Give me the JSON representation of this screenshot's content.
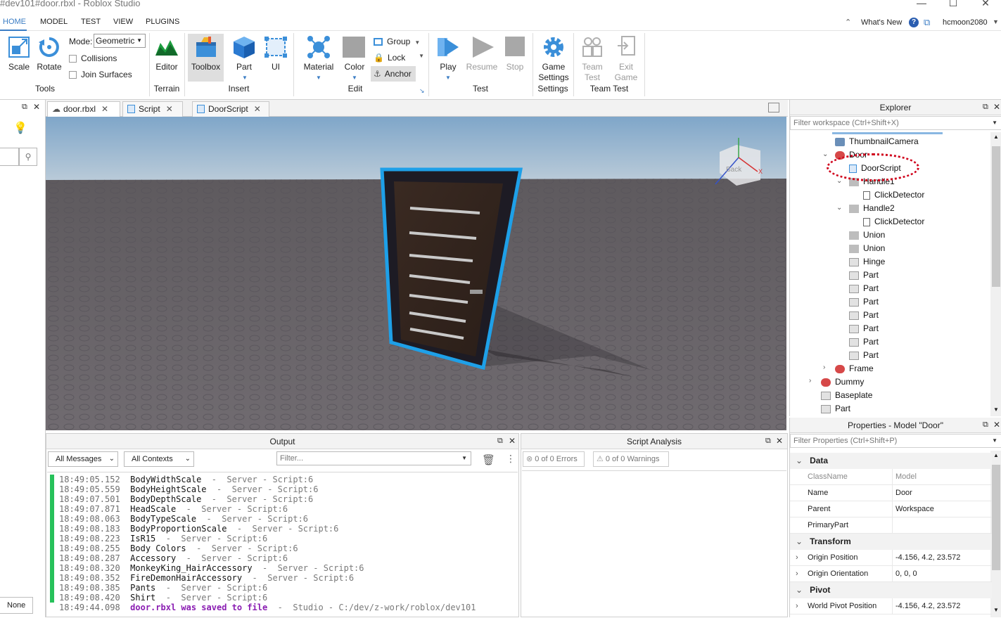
{
  "window": {
    "title": "#dev101#door.rbxl - Roblox Studio"
  },
  "menu": {
    "tabs": [
      "HOME",
      "MODEL",
      "TEST",
      "VIEW",
      "PLUGINS"
    ],
    "active": "HOME",
    "whats_new": "What's New",
    "user": "hcmoon2080"
  },
  "ribbon": {
    "tools": {
      "scale": "Scale",
      "rotate": "Rotate",
      "mode_label": "Mode:",
      "mode_value": "Geometric",
      "collisions": "Collisions",
      "join_surfaces": "Join Surfaces",
      "group": "Tools"
    },
    "terrain": {
      "editor": "Editor",
      "group": "Terrain"
    },
    "insert": {
      "toolbox": "Toolbox",
      "part": "Part",
      "ui": "UI",
      "group": "Insert"
    },
    "edit": {
      "material": "Material",
      "color": "Color",
      "group_btn": "Group",
      "lock": "Lock",
      "anchor": "Anchor",
      "group": "Edit"
    },
    "test": {
      "play": "Play",
      "resume": "Resume",
      "stop": "Stop",
      "group": "Test"
    },
    "settings": {
      "game_settings_1": "Game",
      "game_settings_2": "Settings",
      "group": "Settings"
    },
    "team_test": {
      "team_test_1": "Team",
      "team_test_2": "Test",
      "exit_game_1": "Exit",
      "exit_game_2": "Game",
      "group": "Team Test"
    }
  },
  "doc_tabs": [
    {
      "label": "door.rbxl"
    },
    {
      "label": "Script"
    },
    {
      "label": "DoorScript"
    }
  ],
  "left_panel": {
    "none_label": "None"
  },
  "output": {
    "title": "Output",
    "filter_messages": "All Messages",
    "filter_contexts": "All Contexts",
    "filter_placeholder": "Filter...",
    "logs": [
      {
        "time": "18:49:05.152",
        "msg": "BodyWidthScale",
        "src": "  -  Server - Script:6"
      },
      {
        "time": "18:49:05.559",
        "msg": "BodyHeightScale",
        "src": "  -  Server - Script:6"
      },
      {
        "time": "18:49:07.501",
        "msg": "BodyDepthScale",
        "src": "  -  Server - Script:6"
      },
      {
        "time": "18:49:07.871",
        "msg": "HeadScale",
        "src": "  -  Server - Script:6"
      },
      {
        "time": "18:49:08.063",
        "msg": "BodyTypeScale",
        "src": "  -  Server - Script:6"
      },
      {
        "time": "18:49:08.183",
        "msg": "BodyProportionScale",
        "src": "  -  Server - Script:6"
      },
      {
        "time": "18:49:08.223",
        "msg": "IsR15",
        "src": "  -  Server - Script:6"
      },
      {
        "time": "18:49:08.255",
        "msg": "Body Colors",
        "src": "  -  Server - Script:6"
      },
      {
        "time": "18:49:08.287",
        "msg": "Accessory",
        "src": "  -  Server - Script:6"
      },
      {
        "time": "18:49:08.320",
        "msg": "MonkeyKing_HairAccessory",
        "src": "  -  Server - Script:6"
      },
      {
        "time": "18:49:08.352",
        "msg": "FireDemonHairAccessory",
        "src": "  -  Server - Script:6"
      },
      {
        "time": "18:49:08.385",
        "msg": "Pants",
        "src": "  -  Server - Script:6"
      },
      {
        "time": "18:49:08.420",
        "msg": "Shirt",
        "src": "  -  Server - Script:6"
      }
    ],
    "saved_log": {
      "time": "18:49:44.098",
      "msg": "door.rbxl was saved to file",
      "src": "  -  Studio - C:/dev/z-work/roblox/dev101"
    }
  },
  "analysis": {
    "title": "Script Analysis",
    "errors": "0 of 0 Errors",
    "warnings": "0 of 0 Warnings"
  },
  "explorer": {
    "title": "Explorer",
    "filter_placeholder": "Filter workspace (Ctrl+Shift+X)",
    "items": [
      {
        "label": "ThumbnailCamera",
        "icon": "camera-icon"
      },
      {
        "label": "Door",
        "icon": "model-icon"
      },
      {
        "label": "DoorScript",
        "icon": "script-icon"
      },
      {
        "label": "Handle1",
        "icon": "union-icon"
      },
      {
        "label": "ClickDetector",
        "icon": "click-detector-icon"
      },
      {
        "label": "Handle2",
        "icon": "union-icon"
      },
      {
        "label": "ClickDetector",
        "icon": "click-detector-icon"
      },
      {
        "label": "Union",
        "icon": "union-icon"
      },
      {
        "label": "Union",
        "icon": "union-icon"
      },
      {
        "label": "Hinge",
        "icon": "part-icon"
      },
      {
        "label": "Part",
        "icon": "part-icon"
      },
      {
        "label": "Part",
        "icon": "part-icon"
      },
      {
        "label": "Part",
        "icon": "part-icon"
      },
      {
        "label": "Part",
        "icon": "part-icon"
      },
      {
        "label": "Part",
        "icon": "part-icon"
      },
      {
        "label": "Part",
        "icon": "part-icon"
      },
      {
        "label": "Part",
        "icon": "part-icon"
      },
      {
        "label": "Frame",
        "icon": "model-icon"
      },
      {
        "label": "Dummy",
        "icon": "model-icon"
      },
      {
        "label": "Baseplate",
        "icon": "part-icon"
      },
      {
        "label": "Part",
        "icon": "part-icon"
      }
    ]
  },
  "properties": {
    "title": "Properties - Model \"Door\"",
    "filter_placeholder": "Filter Properties (Ctrl+Shift+P)",
    "sections": {
      "data": "Data",
      "transform": "Transform",
      "pivot": "Pivot"
    },
    "rows": {
      "classname": {
        "k": "ClassName",
        "v": "Model"
      },
      "name": {
        "k": "Name",
        "v": "Door"
      },
      "parent": {
        "k": "Parent",
        "v": "Workspace"
      },
      "primarypart": {
        "k": "PrimaryPart",
        "v": ""
      },
      "origin_position": {
        "k": "Origin Position",
        "v": "-4.156, 4.2, 23.572"
      },
      "origin_orientation": {
        "k": "Origin Orientation",
        "v": "0, 0, 0"
      },
      "world_pivot": {
        "k": "World Pivot Position",
        "v": "-4.156, 4.2, 23.572"
      }
    }
  },
  "viewcube": {
    "face": "Back"
  },
  "colors": {
    "accent": "#3b7dc4",
    "selection": "#1ea0e8",
    "highlight": "#d0021b",
    "log_bar": "#27c15a"
  }
}
